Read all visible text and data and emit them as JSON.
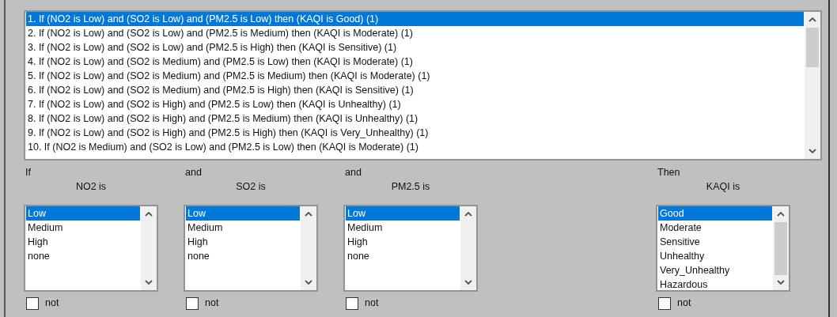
{
  "rules": [
    {
      "text": "1. If (NO2 is Low) and (SO2 is Low) and (PM2.5 is Low) then (KAQI is Good) (1)",
      "selected": true
    },
    {
      "text": "2. If (NO2 is Low) and (SO2 is Low) and (PM2.5 is Medium) then (KAQI is Moderate) (1)",
      "selected": false
    },
    {
      "text": "3. If (NO2 is Low) and (SO2 is Low) and (PM2.5 is High) then (KAQI is Sensitive) (1)",
      "selected": false
    },
    {
      "text": "4. If (NO2 is Low) and (SO2 is Medium) and (PM2.5 is Low) then (KAQI is Moderate) (1)",
      "selected": false
    },
    {
      "text": "5. If (NO2 is Low) and (SO2 is Medium) and (PM2.5 is Medium) then (KAQI is Moderate) (1)",
      "selected": false
    },
    {
      "text": "6. If (NO2 is Low) and (SO2 is Medium) and (PM2.5 is High) then (KAQI is Sensitive) (1)",
      "selected": false
    },
    {
      "text": "7. If (NO2 is Low) and (SO2 is High) and (PM2.5 is Low) then (KAQI is Unhealthy) (1)",
      "selected": false
    },
    {
      "text": "8. If (NO2 is Low) and (SO2 is High) and (PM2.5 is Medium) then (KAQI is Unhealthy) (1)",
      "selected": false
    },
    {
      "text": "9. If (NO2 is Low) and (SO2 is High) and (PM2.5 is High) then (KAQI is Very_Unhealthy) (1)",
      "selected": false
    },
    {
      "text": "10. If (NO2 is Medium) and (SO2 is Low) and (PM2.5 is Low) then (KAQI is Moderate) (1)",
      "selected": false
    }
  ],
  "clauses": [
    {
      "kind": "if",
      "connector": "If",
      "label": "NO2 is",
      "not_checked": false,
      "not_label": "not",
      "options": [
        {
          "text": "Low",
          "selected": true
        },
        {
          "text": "Medium",
          "selected": false
        },
        {
          "text": "High",
          "selected": false
        },
        {
          "text": "none",
          "selected": false
        }
      ]
    },
    {
      "kind": "if",
      "connector": "and",
      "label": "SO2 is",
      "not_checked": false,
      "not_label": "not",
      "options": [
        {
          "text": "Low",
          "selected": true
        },
        {
          "text": "Medium",
          "selected": false
        },
        {
          "text": "High",
          "selected": false
        },
        {
          "text": "none",
          "selected": false
        }
      ]
    },
    {
      "kind": "if",
      "connector": "and",
      "label": "PM2.5 is",
      "not_checked": false,
      "not_label": "not",
      "options": [
        {
          "text": "Low",
          "selected": true
        },
        {
          "text": "Medium",
          "selected": false
        },
        {
          "text": "High",
          "selected": false
        },
        {
          "text": "none",
          "selected": false
        }
      ]
    },
    {
      "kind": "then",
      "connector": "Then",
      "label": "KAQI is",
      "not_checked": false,
      "not_label": "not",
      "options": [
        {
          "text": "Good",
          "selected": true
        },
        {
          "text": "Moderate",
          "selected": false
        },
        {
          "text": "Sensitive",
          "selected": false
        },
        {
          "text": "Unhealthy",
          "selected": false
        },
        {
          "text": "Very_Unhealthy",
          "selected": false
        },
        {
          "text": "Hazardous",
          "selected": false
        }
      ]
    }
  ]
}
